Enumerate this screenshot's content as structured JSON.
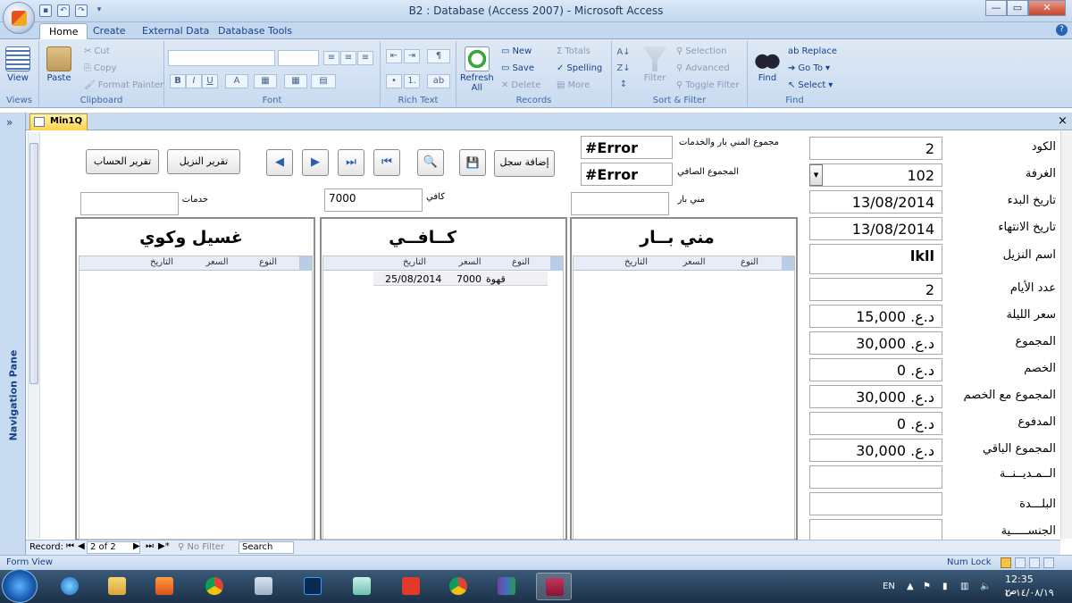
{
  "window": {
    "title": "B2 : Database (Access 2007) - Microsoft Access",
    "controls": [
      "—",
      "▭",
      "✕"
    ]
  },
  "tabs": [
    "Home",
    "Create",
    "External Data",
    "Database Tools"
  ],
  "ribbon": {
    "views": {
      "view": "View",
      "group": "Views"
    },
    "clipboard": {
      "paste": "Paste",
      "cut": "Cut",
      "copy": "Copy",
      "format_painter": "Format Painter",
      "group": "Clipboard"
    },
    "font": {
      "group": "Font",
      "bold": "B",
      "italic": "I",
      "underline": "U",
      "font_color": "A"
    },
    "rich_text": {
      "group": "Rich Text"
    },
    "records": {
      "refresh": "Refresh",
      "refresh_sub": "All",
      "new": "New",
      "save": "Save",
      "delete": "Delete",
      "totals": "Totals",
      "spelling": "Spelling",
      "more": "More",
      "group": "Records"
    },
    "sort_filter": {
      "filter": "Filter",
      "selection": "Selection",
      "advanced": "Advanced",
      "toggle_filter": "Toggle Filter",
      "group": "Sort & Filter"
    },
    "find": {
      "find": "Find",
      "replace": "Replace",
      "goto": "Go To",
      "select": "Select",
      "group": "Find"
    }
  },
  "nav_pane": {
    "label": "Navigation Pane",
    "chevron": "»"
  },
  "doc_tab": {
    "label": "Min1Q",
    "close": "×"
  },
  "form": {
    "buttons": {
      "invoice": "تقرير الحساب",
      "guest_report": "تقرير النزيل",
      "add_record": "إضافة سجل"
    },
    "nav_icons": {
      "prev": "◀",
      "next": "▶",
      "last": "⏭",
      "first": "⏮",
      "find": "🔍",
      "save": "💾"
    },
    "totals": {
      "minibar_services_label": "مجموع المني بار والخدمات",
      "minibar_services_value": "#Error",
      "net_total_label": "المجموع الصافي",
      "net_total_value": "#Error"
    },
    "sub_inputs": {
      "services_label": "خدمات",
      "services_value": "",
      "cafe_label": "كافي",
      "cafe_value": "7000",
      "minibar_label": "مني بار",
      "minibar_value": ""
    },
    "fields": [
      {
        "label": "الكود",
        "value": "2"
      },
      {
        "label": "الغرفة",
        "value": "102"
      },
      {
        "label": "تاريخ البدء",
        "value": "13/08/2014"
      },
      {
        "label": "تاريخ الانتهاء",
        "value": "13/08/2014"
      },
      {
        "label": "اسم النزيل",
        "value": "lkll"
      },
      {
        "label": "عدد الأيام",
        "value": "2"
      },
      {
        "label": "سعر الليلة",
        "value": "د.ع. 15,000"
      },
      {
        "label": "المجموع",
        "value": "د.ع. 30,000"
      },
      {
        "label": "الخصم",
        "value": "د.ع. 0"
      },
      {
        "label": "المجموع مع الخصم",
        "value": "د.ع. 30,000"
      },
      {
        "label": "المدفوع",
        "value": "د.ع. 0"
      },
      {
        "label": "المجموع الباقي",
        "value": "د.ع. 30,000"
      },
      {
        "label": "الــمـديــنــة",
        "value": ""
      },
      {
        "label": "البلـــدة",
        "value": ""
      },
      {
        "label": "الجنســـــية",
        "value": ""
      }
    ],
    "panels": {
      "laundry": {
        "title": "غسيل وكوي",
        "col_type": "النوع",
        "col_price": "السعر",
        "col_date": "التاريخ"
      },
      "cafe": {
        "title": "كــافــي",
        "col_type": "النوع",
        "col_price": "السعر",
        "col_date": "التاريخ",
        "rows": [
          {
            "type": "قهوة",
            "price": "7000",
            "date": "25/08/2014"
          }
        ]
      },
      "minibar": {
        "title": "مني بــار",
        "col_type": "النوع",
        "col_price": "السعر",
        "col_date": "التاريخ"
      }
    }
  },
  "record_nav": {
    "label": "Record:",
    "position": "2 of 2",
    "filter": "No Filter",
    "search": "Search"
  },
  "status": {
    "left": "Form View",
    "right": "Num Lock"
  },
  "taskbar": {
    "lang": "EN",
    "time": "12:35 ص",
    "date": "٢٠١٤/٠٨/١٩"
  }
}
